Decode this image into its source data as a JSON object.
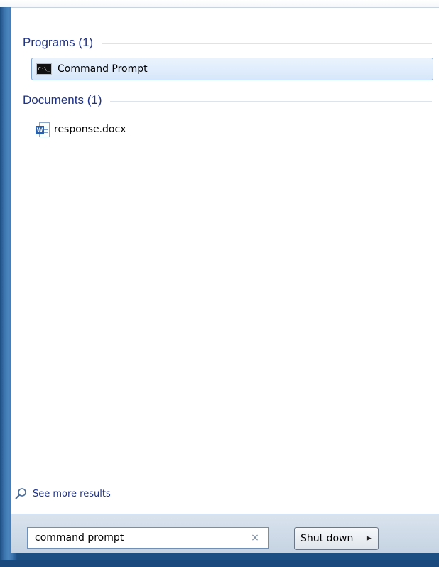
{
  "groups": {
    "programs": {
      "title": "Programs (1)",
      "items": [
        {
          "label": "Command Prompt",
          "icon": "command-prompt-icon",
          "icon_text": "C:\\_"
        }
      ]
    },
    "documents": {
      "title": "Documents (1)",
      "items": [
        {
          "label": "response.docx",
          "icon": "word-document-icon",
          "icon_text": "W"
        }
      ]
    }
  },
  "see_more": {
    "label": "See more results",
    "icon": "search-icon"
  },
  "search": {
    "value": "command prompt",
    "clear_icon": "×",
    "clear_icon_name": "close-icon"
  },
  "power": {
    "shutdown_label": "Shut down",
    "arrow_glyph": "▶"
  },
  "colors": {
    "group_title": "#1e3287",
    "highlight_border": "#7da2ce",
    "frame_blue": "#2a5c8f"
  }
}
